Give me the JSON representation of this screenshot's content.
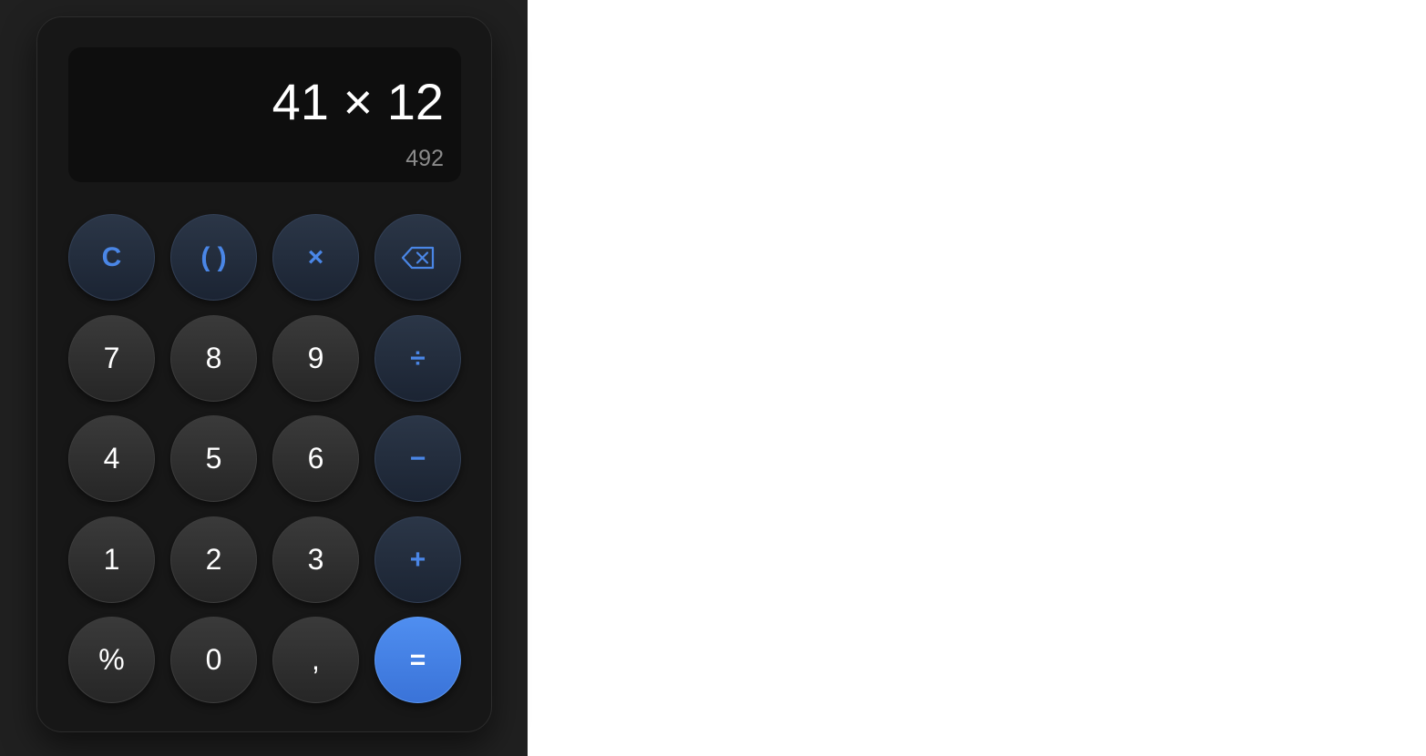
{
  "display": {
    "expression": "41 × 12",
    "result": "492"
  },
  "keys": {
    "clear": "C",
    "parentheses": "( )",
    "multiply": "×",
    "backspace_icon": "backspace-icon",
    "seven": "7",
    "eight": "8",
    "nine": "9",
    "divide": "÷",
    "four": "4",
    "five": "5",
    "six": "6",
    "minus": "−",
    "one": "1",
    "two": "2",
    "three": "3",
    "plus": "+",
    "percent": "%",
    "zero": "0",
    "decimal": ",",
    "equals": "="
  },
  "colors": {
    "accent": "#4a86e6",
    "equals_button": "#4a86e6",
    "number_key": "#2f2f2f",
    "operator_key": "#222d3d",
    "display_background": "#0e0e0e",
    "calculator_body": "#171717",
    "result_text": "#8b8b8b"
  }
}
